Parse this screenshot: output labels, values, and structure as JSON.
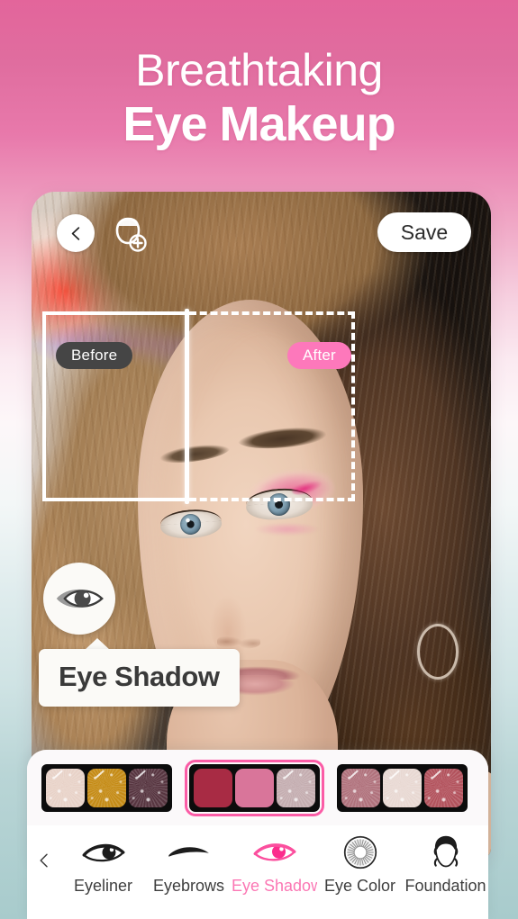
{
  "headline": {
    "line1": "Breathtaking",
    "line2": "Eye Makeup"
  },
  "colors": {
    "accent_pink": "#fb5ca6",
    "after_pill": "#fd78bb",
    "before_pill": "#454545",
    "active_label": "#fb77b4",
    "bg_top": "#e3659b",
    "bg_bottom": "#a8cbcc"
  },
  "editor": {
    "back_icon": "chevron-left-icon",
    "add_face_icon": "face-add-icon",
    "save_label": "Save",
    "compare": {
      "before_label": "Before",
      "after_label": "After"
    },
    "tool_bubble_icon": "eye-icon",
    "callout_label": "Eye Shadow"
  },
  "palettes": [
    {
      "id": "palette-1",
      "selected": false,
      "swatches": [
        {
          "name": "champagne-shimmer",
          "color": "#e8d2c8",
          "glitter": true
        },
        {
          "name": "golden-amber",
          "color": "#c58b16",
          "glitter": true
        },
        {
          "name": "dark-plum",
          "color": "#573540",
          "glitter": true
        }
      ]
    },
    {
      "id": "palette-2",
      "selected": true,
      "swatches": [
        {
          "name": "deep-crimson",
          "color": "#a82b44",
          "glitter": false
        },
        {
          "name": "rose-pink",
          "color": "#d9759a",
          "glitter": false
        },
        {
          "name": "mauve-taupe-shimmer",
          "color": "#c4adb0",
          "glitter": true
        }
      ]
    },
    {
      "id": "palette-3",
      "selected": false,
      "swatches": [
        {
          "name": "dusty-rose-shimmer",
          "color": "#b0727c",
          "glitter": true
        },
        {
          "name": "pale-cream-shimmer",
          "color": "#e8d8d2",
          "glitter": true
        },
        {
          "name": "brick-red-shimmer",
          "color": "#b2525c",
          "glitter": true
        }
      ]
    }
  ],
  "toolbar": {
    "back_icon": "chevron-left-icon",
    "items": [
      {
        "label": "Eyeliner",
        "icon": "eyeliner-icon",
        "active": false
      },
      {
        "label": "Eyebrows",
        "icon": "eyebrow-icon",
        "active": false
      },
      {
        "label": "Eye Shadow",
        "icon": "eyeshadow-icon",
        "active": true
      },
      {
        "label": "Eye Color",
        "icon": "contact-lens-icon",
        "active": false
      },
      {
        "label": "Foundation",
        "icon": "foundation-icon",
        "active": false
      }
    ]
  }
}
